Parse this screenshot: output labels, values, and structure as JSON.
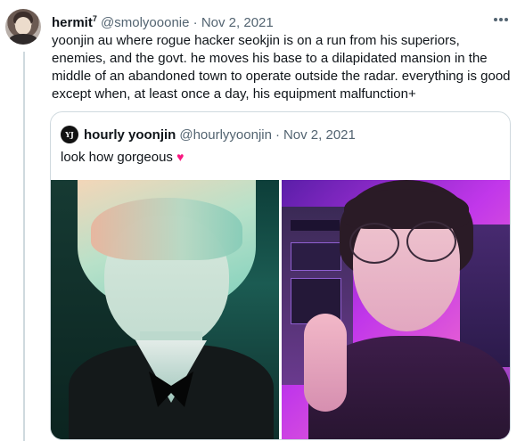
{
  "tweet": {
    "display_name": "hermit",
    "name_superscript": "7",
    "handle": "@smolyooonie",
    "separator": "·",
    "date": "Nov 2, 2021",
    "more_icon": "ellipsis-icon",
    "text": "yoonjin au where rogue hacker seokjin is on a run from his superiors, enemies, and the govt. he moves his base to a dilapidated mansion in the middle of an abandoned town to operate outside the radar. everything is good except when, at least once a day, his equipment malfunction+"
  },
  "quote": {
    "avatar_label": "YJ",
    "display_name": "hourly yoonjin",
    "handle": "@hourlyyoonjin",
    "separator": "·",
    "date": "Nov 2, 2021",
    "text": "look how gorgeous",
    "emoji": "♥",
    "images": [
      "photo-left",
      "photo-right"
    ]
  },
  "colors": {
    "link_gray": "#536471",
    "border": "#cfd9de",
    "heart": "#f91880"
  }
}
